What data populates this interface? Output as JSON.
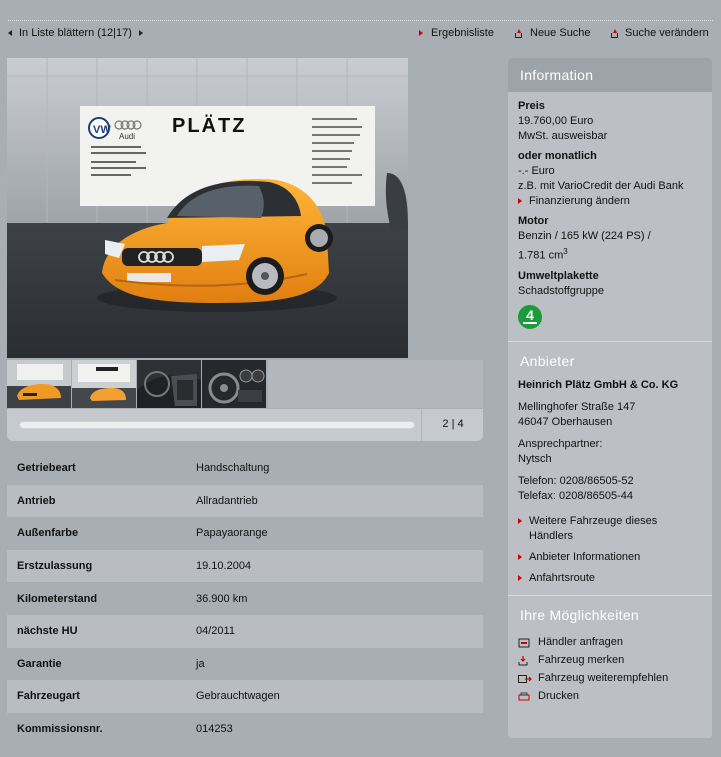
{
  "nav": {
    "browse_label": "In Liste blättern (12|17)",
    "results_label": "Ergebnisliste",
    "new_search_label": "Neue Suche",
    "modify_search_label": "Suche verändern"
  },
  "gallery": {
    "sign_brand": "PLÄTZ",
    "sign_audi": "Audi",
    "page_indicator": "2 | 4"
  },
  "details": [
    {
      "label": "Getriebeart",
      "value": "Handschaltung"
    },
    {
      "label": "Antrieb",
      "value": "Allradantrieb"
    },
    {
      "label": "Außenfarbe",
      "value": "Papayaorange"
    },
    {
      "label": "Erstzulassung",
      "value": "19.10.2004"
    },
    {
      "label": "Kilometerstand",
      "value": "36.900 km"
    },
    {
      "label": "nächste HU",
      "value": "04/2011"
    },
    {
      "label": "Garantie",
      "value": "ja"
    },
    {
      "label": "Fahrzeugart",
      "value": "Gebrauchtwagen"
    },
    {
      "label": "Kommissionsnr.",
      "value": "014253"
    }
  ],
  "info": {
    "title": "Information",
    "price_label": "Preis",
    "price_value": "19.760,00 Euro",
    "vat_note": "MwSt. ausweisbar",
    "monthly_label": "oder monatlich",
    "monthly_value": "-.- Euro",
    "credit_note": "z.B. mit VarioCredit der Audi Bank",
    "finance_link": "Finanzierung ändern",
    "engine_label": "Motor",
    "engine_line1": "Benzin / 165 kW (224 PS) /",
    "engine_line2": "1.781 cm",
    "engine_sup": "3",
    "env_label": "Umweltplakette",
    "env_value": "Schadstoffgruppe",
    "env_badge": "4"
  },
  "dealer": {
    "title": "Anbieter",
    "name": "Heinrich Plätz GmbH & Co. KG",
    "street": "Mellinghofer Straße 147",
    "city": "46047 Oberhausen",
    "contact_label": "Ansprechpartner:",
    "contact_name": "Nytsch",
    "phone": "Telefon: 0208/86505-52",
    "fax": "Telefax: 0208/86505-44",
    "link_more_line1": "Weitere Fahrzeuge dieses",
    "link_more_line2": "Händlers",
    "link_info": "Anbieter Informationen",
    "link_route": "Anfahrtsroute"
  },
  "options": {
    "title": "Ihre Möglichkeiten",
    "ask": "Händler anfragen",
    "remember": "Fahrzeug merken",
    "recommend": "Fahrzeug weiterempfehlen",
    "print": "Drucken"
  }
}
